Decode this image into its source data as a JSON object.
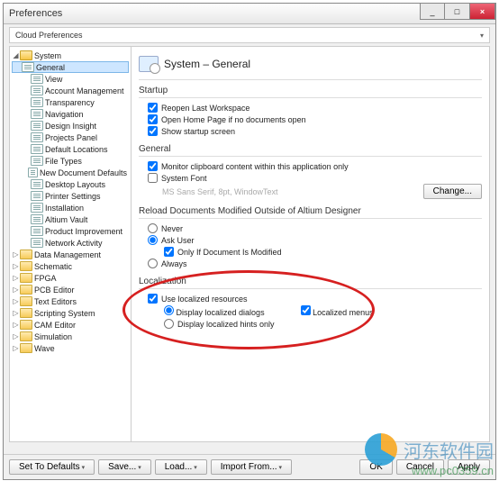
{
  "window": {
    "title": "Preferences"
  },
  "cloud": {
    "label": "Cloud Preferences"
  },
  "tree": {
    "system": "System",
    "items": [
      "General",
      "View",
      "Account Management",
      "Transparency",
      "Navigation",
      "Design Insight",
      "Projects Panel",
      "Default Locations",
      "File Types",
      "New Document Defaults",
      "Desktop Layouts",
      "Printer Settings",
      "Installation",
      "Altium Vault",
      "Product Improvement",
      "Network Activity"
    ],
    "roots": [
      "Data Management",
      "Schematic",
      "FPGA",
      "PCB Editor",
      "Text Editors",
      "Scripting System",
      "CAM Editor",
      "Simulation",
      "Wave"
    ]
  },
  "header": {
    "title": "System – General"
  },
  "startup": {
    "title": "Startup",
    "reopen": "Reopen Last Workspace",
    "openhome": "Open Home Page if no documents open",
    "showstartup": "Show startup screen"
  },
  "general": {
    "title": "General",
    "monitor": "Monitor clipboard content within this application only",
    "sysfont": "System Font",
    "fontsample": "MS Sans Serif, 8pt, WindowText",
    "change": "Change..."
  },
  "reload": {
    "title": "Reload Documents Modified Outside of Altium Designer",
    "never": "Never",
    "ask": "Ask User",
    "onlymod": "Only If Document Is Modified",
    "always": "Always"
  },
  "loc": {
    "title": "Localization",
    "use": "Use localized resources",
    "dialogs": "Display localized dialogs",
    "menus": "Localized menus",
    "hints": "Display localized hints only"
  },
  "footer": {
    "defaults": "Set To Defaults",
    "save": "Save...",
    "load": "Load...",
    "import": "Import From...",
    "ok": "OK",
    "cancel": "Cancel",
    "apply": "Apply"
  },
  "watermark": {
    "text": "河东软件园",
    "url": "www.pc0359.cn"
  }
}
